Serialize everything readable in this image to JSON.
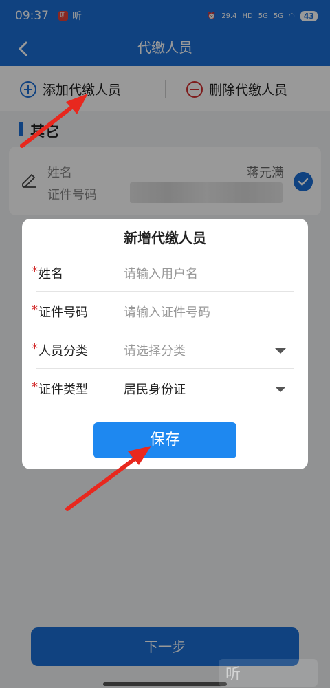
{
  "status": {
    "time": "09:37",
    "app_badge": "听",
    "listen": "听",
    "speed": "29.4",
    "net1": "HD",
    "net2": "5G",
    "net3": "5G",
    "battery": "43"
  },
  "header": {
    "title": "代缴人员"
  },
  "actions": {
    "add_label": "添加代缴人员",
    "delete_label": "删除代缴人员"
  },
  "section": {
    "title": "其它"
  },
  "person": {
    "name_label": "姓名",
    "id_label": "证件号码",
    "name_value": "蒋元满"
  },
  "dialog": {
    "title": "新增代缴人员",
    "required_mark": "*",
    "fields": [
      {
        "label": "姓名",
        "placeholder": "请输入用户名"
      },
      {
        "label": "证件号码",
        "placeholder": "请输入证件号码"
      },
      {
        "label": "人员分类",
        "placeholder": "请选择分类"
      },
      {
        "label": "证件类型",
        "value": "居民身份证"
      }
    ],
    "save_label": "保存"
  },
  "footer": {
    "next_label": "下一步"
  },
  "watermark": {
    "glyph": "听"
  },
  "colors": {
    "primary": "#1c6fd6",
    "save": "#1e88f0",
    "required": "#d32f2f",
    "delete": "#d32f2f",
    "arrow": "#e8281e"
  }
}
